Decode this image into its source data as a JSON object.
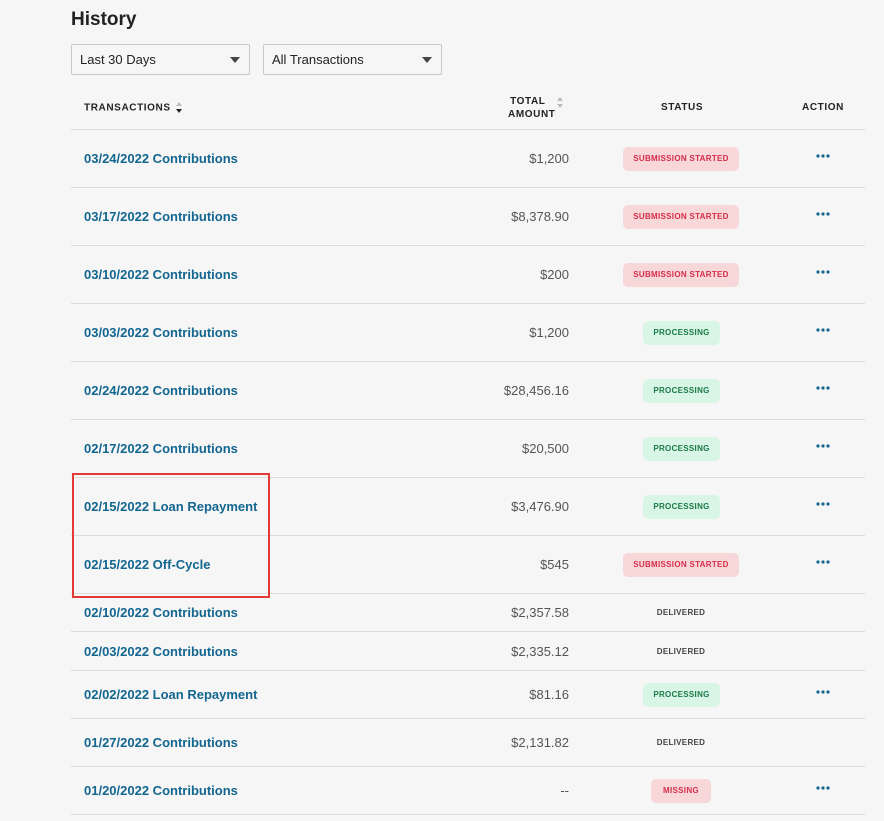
{
  "page": {
    "title": "History"
  },
  "filters": {
    "period": {
      "selected": "Last 30 Days"
    },
    "type": {
      "selected": "All Transactions"
    }
  },
  "table": {
    "headers": {
      "transactions": "TRANSACTIONS",
      "total_amount_line1": "TOTAL",
      "total_amount_line2": "AMOUNT",
      "status": "STATUS",
      "action": "ACTION"
    },
    "rows": [
      {
        "label": "03/24/2022 Contributions",
        "amount": "$1,200",
        "status": "SUBMISSION STARTED"
      },
      {
        "label": "03/17/2022 Contributions",
        "amount": "$8,378.90",
        "status": "SUBMISSION STARTED"
      },
      {
        "label": "03/10/2022 Contributions",
        "amount": "$200",
        "status": "SUBMISSION STARTED"
      },
      {
        "label": "03/03/2022 Contributions",
        "amount": "$1,200",
        "status": "PROCESSING"
      },
      {
        "label": "02/24/2022 Contributions",
        "amount": "$28,456.16",
        "status": "PROCESSING"
      },
      {
        "label": "02/17/2022 Contributions",
        "amount": "$20,500",
        "status": "PROCESSING"
      },
      {
        "label": "02/15/2022 Loan Repayment",
        "amount": "$3,476.90",
        "status": "PROCESSING"
      },
      {
        "label": "02/15/2022 Off-Cycle",
        "amount": "$545",
        "status": "SUBMISSION STARTED"
      },
      {
        "label": "02/10/2022 Contributions",
        "amount": "$2,357.58",
        "status": "DELIVERED"
      },
      {
        "label": "02/03/2022 Contributions",
        "amount": "$2,335.12",
        "status": "DELIVERED"
      },
      {
        "label": "02/02/2022 Loan Repayment",
        "amount": "$81.16",
        "status": "PROCESSING"
      },
      {
        "label": "01/27/2022 Contributions",
        "amount": "$2,131.82",
        "status": "DELIVERED"
      },
      {
        "label": "01/20/2022 Contributions",
        "amount": "--",
        "status": "MISSING"
      }
    ]
  },
  "icons": {
    "row_action": "more-horizontal-icon",
    "select_arrow": "caret-down-icon",
    "sort": "sort-icon"
  },
  "colors": {
    "link": "#12668f",
    "submission_bg": "#f8d7d9",
    "submission_text": "#d62d4a",
    "processing_bg": "#d9f5e6",
    "processing_text": "#1a7a47",
    "highlight": "#e53935"
  }
}
